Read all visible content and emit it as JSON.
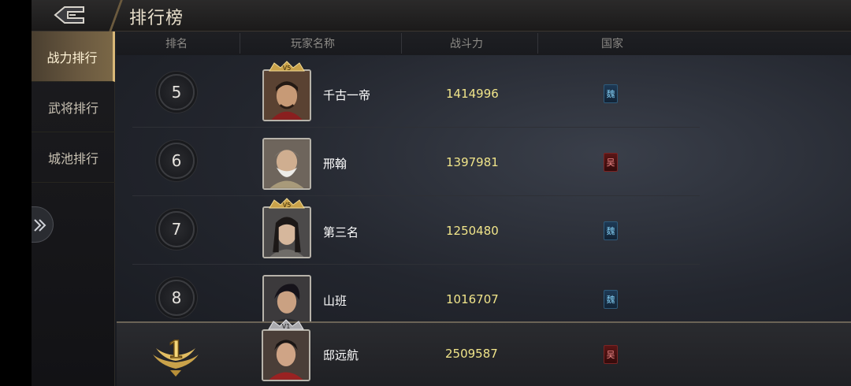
{
  "header": {
    "title": "排行榜"
  },
  "sidebar": {
    "tabs": [
      {
        "label": "战力排行",
        "active": true
      },
      {
        "label": "武将排行",
        "active": false
      },
      {
        "label": "城池排行",
        "active": false
      }
    ]
  },
  "table": {
    "columns": [
      "排名",
      "玩家名称",
      "战斗力",
      "国家"
    ],
    "rows": [
      {
        "rank": "5",
        "name": "千古一帝",
        "power": "1414996",
        "nation": "魏",
        "vip": "V5"
      },
      {
        "rank": "6",
        "name": "邢翰",
        "power": "1397981",
        "nation": "吴",
        "vip": ""
      },
      {
        "rank": "7",
        "name": "第三名",
        "power": "1250480",
        "nation": "魏",
        "vip": "V5"
      },
      {
        "rank": "8",
        "name": "山班",
        "power": "1016707",
        "nation": "魏",
        "vip": ""
      }
    ]
  },
  "self_entry": {
    "rank": "1",
    "name": "邸远航",
    "power": "2509587",
    "nation": "吴",
    "vip": "V1"
  },
  "colors": {
    "accent_gold": "#d9b878",
    "power_text": "#f1e58a",
    "wei_blue": "#7fc9ee",
    "wu_red": "#f08a8a"
  }
}
